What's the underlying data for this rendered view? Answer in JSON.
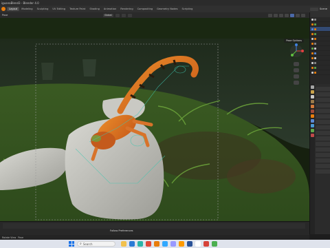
{
  "window": {
    "title": "iguanaBlend3 - Blender 4.0"
  },
  "workspaces": [
    "Layout",
    "Modeling",
    "Sculpting",
    "UV Editing",
    "Texture Paint",
    "Shading",
    "Animation",
    "Rendering",
    "Compositing",
    "Geometry Nodes",
    "Scripting"
  ],
  "scene_label": "Scene",
  "viewport": {
    "mode_label": "Pose",
    "transform_label": "Global",
    "pose_options_label": "Pose Options",
    "follow_label": "Follow Preferences"
  },
  "status_bar": {
    "left": "Rotate View",
    "mode": "Pose"
  },
  "taskbar": {
    "search_placeholder": "Search"
  },
  "colors": {
    "blender_orange": "#e87d0d",
    "selection_blue": "#4b6aa8",
    "windows_blue": "#1a73e8",
    "taskbar_bg": "#dfe3ec"
  }
}
